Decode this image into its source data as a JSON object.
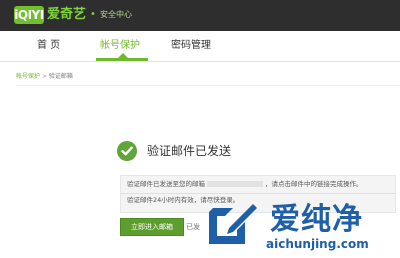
{
  "header": {
    "logo_text": "iQIYI",
    "brand": "爱奇艺",
    "separator": "•",
    "subtitle": "安全中心",
    "colors": {
      "topbar": "#2e2e2e",
      "brand_green": "#6fc02a"
    }
  },
  "nav": {
    "tabs": [
      {
        "label": "首 页"
      },
      {
        "label": "帐号保护",
        "active": true
      },
      {
        "label": "密码管理"
      }
    ],
    "active_color": "#6fba2c"
  },
  "breadcrumb": {
    "parent": "帐号保护",
    "separator": ">",
    "current": "验证邮箱"
  },
  "main": {
    "status_icon": "check-circle-icon",
    "heading": "验证邮件已发送",
    "info_line1_prefix": "验证邮件已发送至您的邮箱",
    "info_line1_suffix": "，请点击邮件中的链接完成操作。",
    "info_line2": "验证邮件24小时内有效，请尽快登录。",
    "go_button": "立即进入邮箱",
    "resend_text": "已发"
  },
  "watermark": {
    "icon": "aichunjing-logo-icon",
    "text": "爱纯净",
    "url": "aichunjing.com",
    "color": "#1e5fa8"
  }
}
